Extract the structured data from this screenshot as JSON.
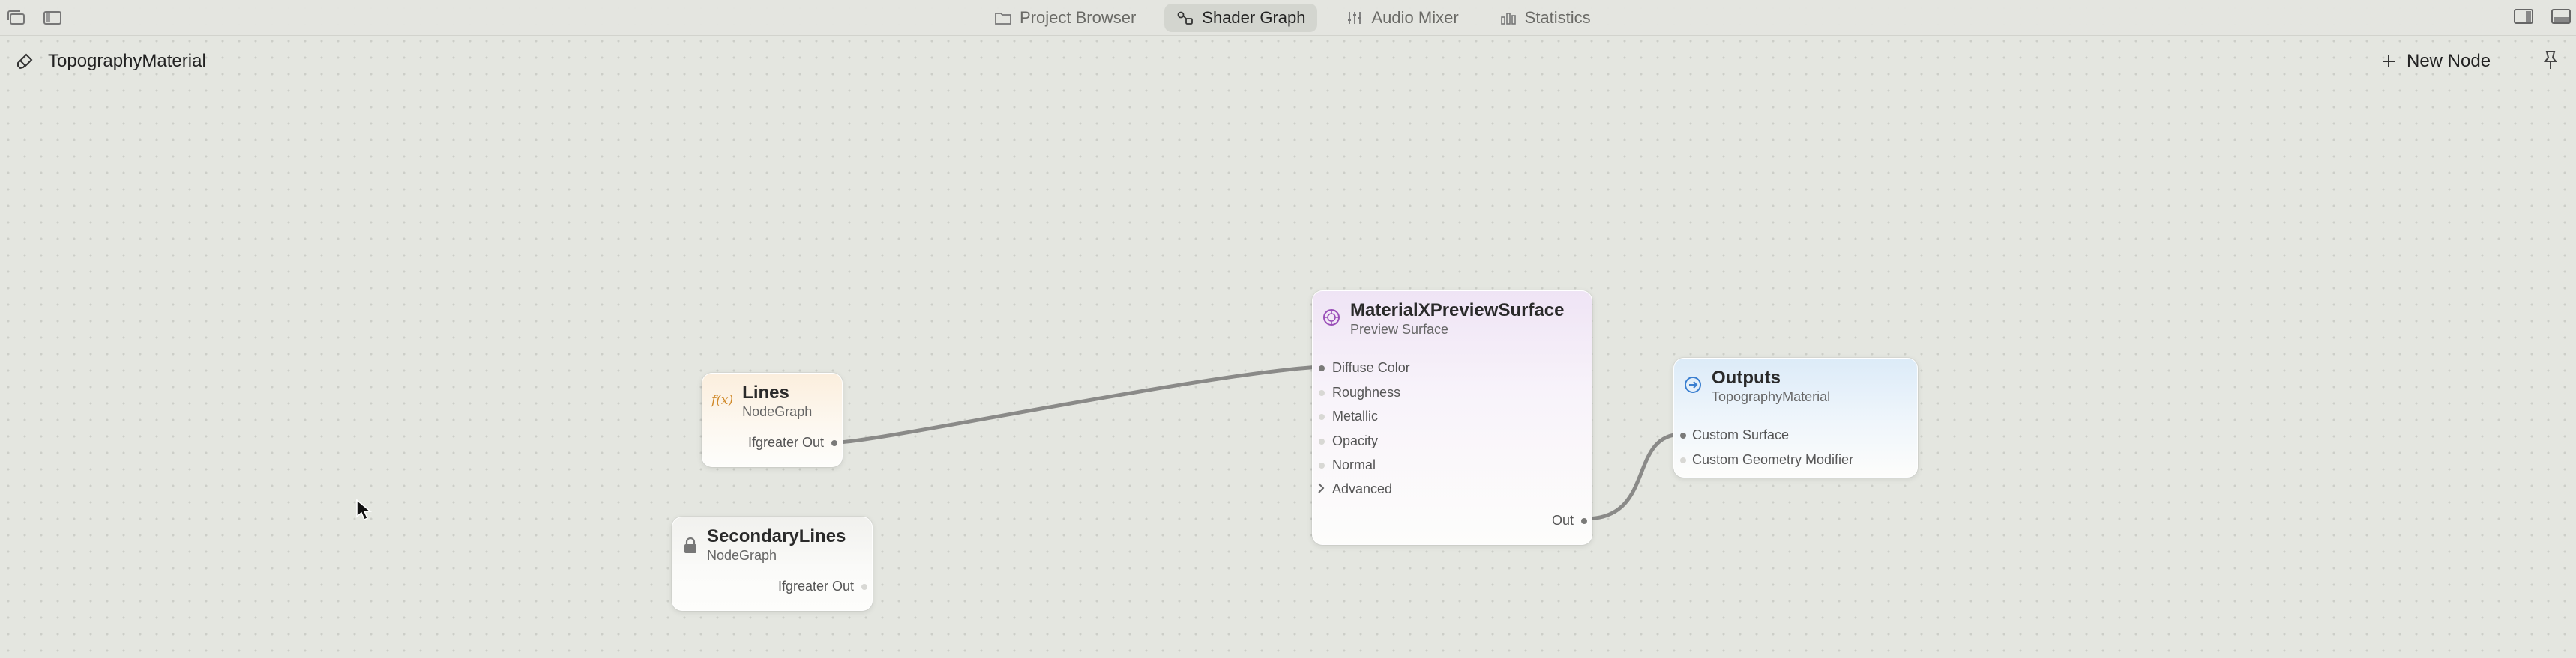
{
  "toolbar": {
    "tabs": [
      {
        "label": "Project Browser",
        "icon": "folder-icon",
        "active": false
      },
      {
        "label": "Shader Graph",
        "icon": "node-graph-icon",
        "active": true
      },
      {
        "label": "Audio Mixer",
        "icon": "audio-mixer-icon",
        "active": false
      },
      {
        "label": "Statistics",
        "icon": "statistics-icon",
        "active": false
      }
    ]
  },
  "subbar": {
    "title": "TopographyMaterial",
    "new_node_label": "New Node"
  },
  "nodes": {
    "lines": {
      "title": "Lines",
      "subtitle": "NodeGraph",
      "icon_text": "f(x)",
      "outputs": [
        "Ifgreater Out"
      ]
    },
    "secondary": {
      "title": "SecondaryLines",
      "subtitle": "NodeGraph",
      "outputs": [
        "Ifgreater Out"
      ]
    },
    "material": {
      "title": "MaterialXPreviewSurface",
      "subtitle": "Preview Surface",
      "inputs": [
        "Diffuse Color",
        "Roughness",
        "Metallic",
        "Opacity",
        "Normal",
        "Advanced"
      ],
      "outputs": [
        "Out"
      ]
    },
    "outputs": {
      "title": "Outputs",
      "subtitle": "TopographyMaterial",
      "inputs": [
        "Custom Surface",
        "Custom Geometry Modifier"
      ]
    }
  },
  "colors": {
    "canvas": "#e4e6e0",
    "lines_header": "#fbeedd",
    "material_header": "#efe4f5",
    "outputs_header": "#dcebf8",
    "edge": "#8a8a88"
  }
}
